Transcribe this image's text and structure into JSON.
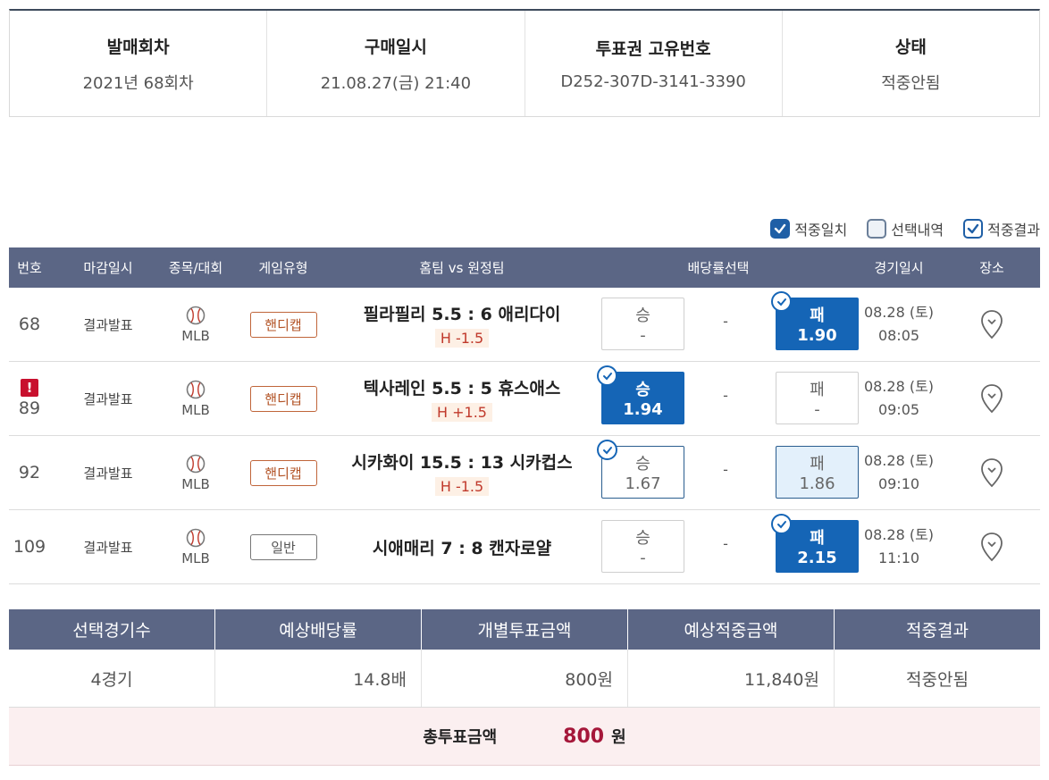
{
  "info": [
    {
      "label": "발매회차",
      "value": "2021년 68회차"
    },
    {
      "label": "구매일시",
      "value": "21.08.27(금) 21:40"
    },
    {
      "label": "투표권 고유번호",
      "value": "D252-307D-3141-3390"
    },
    {
      "label": "상태",
      "value": "적중안됨"
    }
  ],
  "legend": [
    {
      "label": "적중일치",
      "style": "filled"
    },
    {
      "label": "선택내역",
      "style": "empty"
    },
    {
      "label": "적중결과",
      "style": "outline"
    }
  ],
  "headers": {
    "no": "번호",
    "close": "마감일시",
    "sport": "종목/대회",
    "type": "게임유형",
    "teams": "홈팀 vs 원정팀",
    "odds": "배당률선택",
    "date": "경기일시",
    "venue": "장소"
  },
  "games": [
    {
      "no": "68",
      "warn": "",
      "close": "결과발표",
      "league": "MLB",
      "type": "핸디캡",
      "type_style": "handi",
      "teams": "필라필리 5.5 : 6 애리다이",
      "handicap": "H -1.5",
      "win_label": "승",
      "win_odds": "-",
      "draw": "-",
      "lose_label": "패",
      "lose_odds": "1.90",
      "date": "08.28 (토)",
      "time": "08:05"
    },
    {
      "no": "89",
      "warn": "!",
      "close": "결과발표",
      "league": "MLB",
      "type": "핸디캡",
      "type_style": "handi",
      "teams": "텍사레인 5.5 : 5 휴스애스",
      "handicap": "H +1.5",
      "win_label": "승",
      "win_odds": "1.94",
      "draw": "-",
      "lose_label": "패",
      "lose_odds": "-",
      "date": "08.28 (토)",
      "time": "09:05"
    },
    {
      "no": "92",
      "warn": "",
      "close": "결과발표",
      "league": "MLB",
      "type": "핸디캡",
      "type_style": "handi",
      "teams": "시카화이 15.5 : 13 시카컵스",
      "handicap": "H -1.5",
      "win_label": "승",
      "win_odds": "1.67",
      "draw": "-",
      "lose_label": "패",
      "lose_odds": "1.86",
      "date": "08.28 (토)",
      "time": "09:10"
    },
    {
      "no": "109",
      "warn": "",
      "close": "결과발표",
      "league": "MLB",
      "type": "일반",
      "type_style": "normal",
      "teams": "시애매리 7 : 8 캔자로얄",
      "handicap": "",
      "win_label": "승",
      "win_odds": "-",
      "draw": "-",
      "lose_label": "패",
      "lose_odds": "2.15",
      "date": "08.28 (토)",
      "time": "11:10"
    }
  ],
  "summary": {
    "headers": [
      "선택경기수",
      "예상배당률",
      "개별투표금액",
      "예상적중금액",
      "적중결과"
    ],
    "values": [
      "4경기",
      "14.8배",
      "800원",
      "11,840원",
      "적중안됨"
    ],
    "total_label": "총투표금액",
    "total_amount": "800",
    "total_unit": "원"
  },
  "colors": {
    "header_bg": "#5b6685",
    "selected": "#1565b6",
    "accent_red": "#a5173a"
  }
}
